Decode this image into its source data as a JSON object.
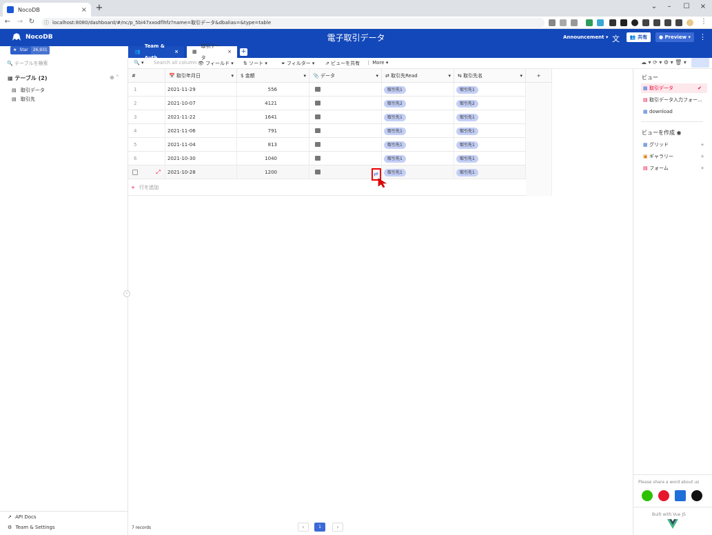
{
  "browser": {
    "tab_title": "NocoDB",
    "url": "localhost:8080/dashboard/#/nc/p_5bi47xxodflhfz?name=取引データ&dbalias=&type=table"
  },
  "header": {
    "brand": "NocoDB",
    "star_label": "Star",
    "star_count": "26,931",
    "project_title": "電子取引データ",
    "announcement": "Announcement",
    "share": "共有",
    "preview": "Preview"
  },
  "sidebar": {
    "search_placeholder": "テーブルを検索",
    "tables_header": "テーブル (2)",
    "tables": [
      "取引データ",
      "取引先"
    ],
    "api_docs": "API Docs",
    "team_settings": "Team & Settings"
  },
  "tabs": [
    {
      "label": "Team & Auth"
    },
    {
      "label": "取引データ"
    }
  ],
  "toolbar": {
    "search_placeholder": "Search all column",
    "fields": "フィールド",
    "sort": "ソート",
    "filter": "フィルター",
    "share_view": "ビューを共有",
    "more": "More"
  },
  "grid": {
    "columns": [
      "#",
      "取引年月日",
      "金額",
      "データ",
      "取引先Read",
      "取引先名"
    ],
    "rows": [
      {
        "num": "1",
        "date": "2021-11-29",
        "amount": "556",
        "read": "取引先1",
        "name": "取引先1"
      },
      {
        "num": "2",
        "date": "2021-10-07",
        "amount": "4121",
        "read": "取引先2",
        "name": "取引先2"
      },
      {
        "num": "3",
        "date": "2021-11-22",
        "amount": "1641",
        "read": "取引先1",
        "name": "取引先1"
      },
      {
        "num": "4",
        "date": "2021-11-06",
        "amount": "791",
        "read": "取引先1",
        "name": "取引先1"
      },
      {
        "num": "5",
        "date": "2021-11-04",
        "amount": "813",
        "read": "取引先1",
        "name": "取引先1"
      },
      {
        "num": "6",
        "date": "2021-10-30",
        "amount": "1040",
        "read": "取引先1",
        "name": "取引先1"
      },
      {
        "num": "",
        "date": "2021-10-28",
        "amount": "1200",
        "read": "取引先1",
        "name": "取引先1"
      }
    ],
    "add_row": "行を追加",
    "records": "7 records",
    "page": "1"
  },
  "views": {
    "header": "ビュー",
    "items": [
      "取引データ",
      "取引データ入力フォー...",
      "download"
    ],
    "create_header": "ビューを作成",
    "create": [
      "グリッド",
      "ギャラリー",
      "フォーム"
    ],
    "share_msg": "Please share a word about us",
    "built": "Built with Vue JS"
  },
  "colors": {
    "primary": "#1348ba",
    "chip": "#c4cff6",
    "highlight": "#e00000"
  }
}
